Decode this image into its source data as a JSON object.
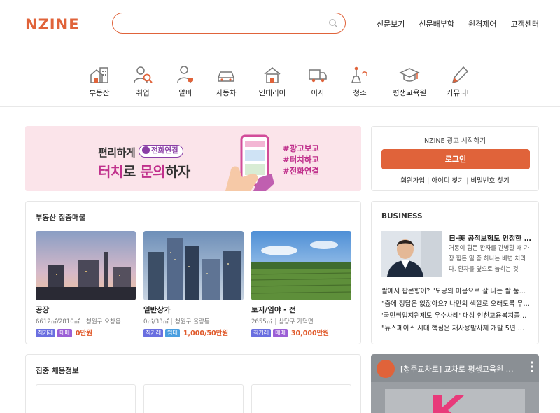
{
  "header": {
    "logo_text": "NZINE",
    "search": {
      "value": "",
      "placeholder": ""
    },
    "nav": [
      "신문보기",
      "신문배부함",
      "원격제어",
      "고객센터"
    ]
  },
  "categories": [
    {
      "label": "부동산",
      "icon": "building-icon"
    },
    {
      "label": "취업",
      "icon": "job-search-icon"
    },
    {
      "label": "알바",
      "icon": "part-time-icon"
    },
    {
      "label": "자동차",
      "icon": "car-icon"
    },
    {
      "label": "인테리어",
      "icon": "interior-icon"
    },
    {
      "label": "이사",
      "icon": "moving-truck-icon"
    },
    {
      "label": "청소",
      "icon": "cleaning-icon"
    },
    {
      "label": "평생교육원",
      "icon": "graduation-cap-icon"
    },
    {
      "label": "커뮤니티",
      "icon": "community-icon"
    }
  ],
  "banner": {
    "line1": "편리하게",
    "pill": "전화연결",
    "line2_a": "터치",
    "line2_b": "로 ",
    "line2_c": "문의",
    "line2_d": "하자",
    "tags": [
      "#광고보고",
      "#터치하고",
      "#전화연결"
    ]
  },
  "login": {
    "start_text": "NZINE 광고 시작하기",
    "button": "로그인",
    "links": [
      "회원가입",
      "아이디 찾기",
      "비밀번호 찾기"
    ]
  },
  "realestate": {
    "title": "부동산 집중매물",
    "items": [
      {
        "type": "공장",
        "area": "6612㎡/2810㎡",
        "location": "청원구 오창읍",
        "tags": [
          "직거래",
          "매매"
        ],
        "price": "0만원"
      },
      {
        "type": "일반상가",
        "area": "0㎡/33㎡",
        "location": "청원구 율량동",
        "tags": [
          "직거래",
          "임대"
        ],
        "price": "1,000/50만원"
      },
      {
        "type": "토지/임야 - 전",
        "area": "2655㎡",
        "location": "상당구 가덕면",
        "tags": [
          "직거래",
          "매매"
        ],
        "price": "30,000만원"
      }
    ]
  },
  "business": {
    "title": "BUSINESS",
    "headline": "日·美 공적보험도 인정한 …",
    "body": "거동이 힘든 환자를 간병할 때 가장 힘든 일 중 하나는 배변 처리다. 환자를 옆으로 눕히는 것",
    "list": [
      "쌀에서 팝콘향이? \"도공의 마음으로 잘 나는 쌀 품…",
      "\"춤에 정답은 없잖아요? 나만의 색깔로 오래도록 무…",
      "'국민취업지원제도 우수사례' 대상 인천고용복지플…",
      "\"뉴스페이스 시대 핵심은 재사용발사체 개발 5년 …"
    ]
  },
  "jobs": {
    "title": "집중 채용정보"
  },
  "video": {
    "title": "[청주교차로] 교차로 평생교육원 …"
  }
}
